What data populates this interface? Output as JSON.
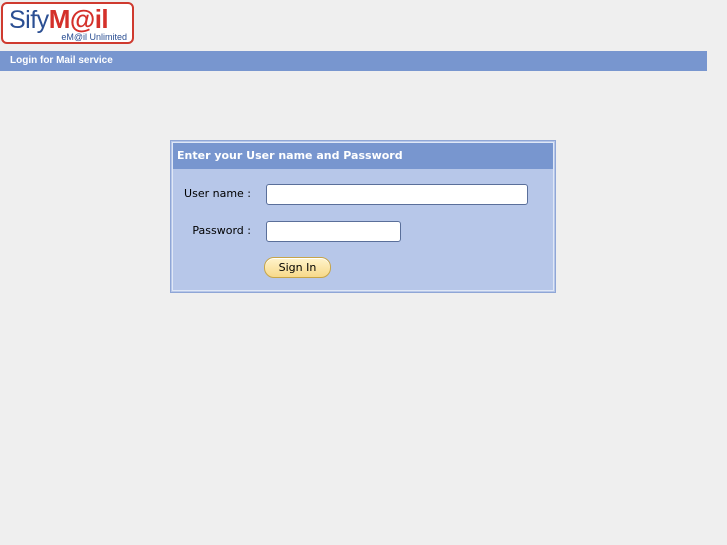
{
  "logo": {
    "brand_sify": "Sify",
    "brand_mail": "M@il",
    "tagline": "eM@il Unlimited"
  },
  "top_bar": {
    "label": "Login for Mail service"
  },
  "login_panel": {
    "heading": "Enter your User name and Password",
    "username_label": "User name :",
    "username_value": "",
    "password_label": "Password :",
    "password_value": "",
    "signin_label": "Sign In"
  },
  "colors": {
    "page_background": "#efefef",
    "bar_blue": "#7896cf",
    "panel_blue": "#b7c7e9",
    "logo_red": "#d4302a",
    "logo_navy": "#2b4f93",
    "button_gold": "#f7d98a"
  }
}
